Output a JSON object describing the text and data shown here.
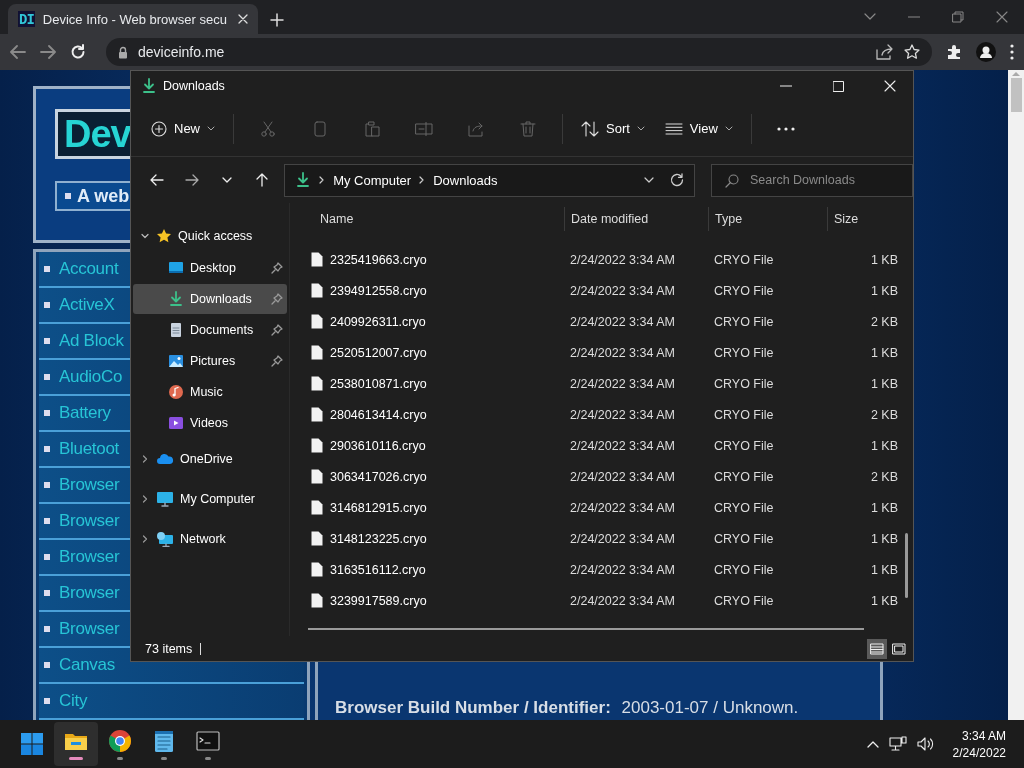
{
  "browser": {
    "tab": {
      "favicon": "DI",
      "title": "Device Info - Web browser secu"
    },
    "url": "deviceinfo.me"
  },
  "website": {
    "logo": "Dev",
    "tagline": "A web",
    "nav": [
      "Account",
      "ActiveX",
      "Ad Block",
      "AudioCo",
      "Battery",
      "Bluetoot",
      "Browser",
      "Browser",
      "Browser",
      "Browser",
      "Browser",
      "Canvas",
      "City"
    ],
    "info": [
      {
        "label": "Browser Build Number / Identifier:",
        "value": "2003-01-07 / Unknown."
      }
    ]
  },
  "explorer": {
    "title": "Downloads",
    "toolbar": {
      "new": "New",
      "actions_disabled": true,
      "sort": "Sort",
      "view": "View"
    },
    "breadcrumb": [
      "My Computer",
      "Downloads"
    ],
    "search": {
      "placeholder": "Search Downloads"
    },
    "nav": [
      {
        "kind": "quick",
        "label": "Quick access",
        "expanded": true,
        "selected": false,
        "children": [
          {
            "kind": "desktop",
            "label": "Desktop",
            "pinned": true,
            "selected": false
          },
          {
            "kind": "downloads",
            "label": "Downloads",
            "pinned": true,
            "selected": true
          },
          {
            "kind": "documents",
            "label": "Documents",
            "pinned": true,
            "selected": false
          },
          {
            "kind": "pictures",
            "label": "Pictures",
            "pinned": true,
            "selected": false
          },
          {
            "kind": "music",
            "label": "Music",
            "pinned": false,
            "selected": false
          },
          {
            "kind": "videos",
            "label": "Videos",
            "pinned": false,
            "selected": false
          }
        ]
      },
      {
        "kind": "onedrive",
        "label": "OneDrive",
        "expanded": false,
        "selected": false
      },
      {
        "kind": "computer",
        "label": "My Computer",
        "expanded": false,
        "selected": false
      },
      {
        "kind": "network",
        "label": "Network",
        "expanded": false,
        "selected": false
      }
    ],
    "columns": [
      "Name",
      "Date modified",
      "Type",
      "Size"
    ],
    "files": [
      {
        "name": "2325419663.cryo",
        "date": "2/24/2022 3:34 AM",
        "type": "CRYO File",
        "size": "1 KB"
      },
      {
        "name": "2394912558.cryo",
        "date": "2/24/2022 3:34 AM",
        "type": "CRYO File",
        "size": "1 KB"
      },
      {
        "name": "2409926311.cryo",
        "date": "2/24/2022 3:34 AM",
        "type": "CRYO File",
        "size": "2 KB"
      },
      {
        "name": "2520512007.cryo",
        "date": "2/24/2022 3:34 AM",
        "type": "CRYO File",
        "size": "1 KB"
      },
      {
        "name": "2538010871.cryo",
        "date": "2/24/2022 3:34 AM",
        "type": "CRYO File",
        "size": "1 KB"
      },
      {
        "name": "2804613414.cryo",
        "date": "2/24/2022 3:34 AM",
        "type": "CRYO File",
        "size": "2 KB"
      },
      {
        "name": "2903610116.cryo",
        "date": "2/24/2022 3:34 AM",
        "type": "CRYO File",
        "size": "1 KB"
      },
      {
        "name": "3063417026.cryo",
        "date": "2/24/2022 3:34 AM",
        "type": "CRYO File",
        "size": "2 KB"
      },
      {
        "name": "3146812915.cryo",
        "date": "2/24/2022 3:34 AM",
        "type": "CRYO File",
        "size": "1 KB"
      },
      {
        "name": "3148123225.cryo",
        "date": "2/24/2022 3:34 AM",
        "type": "CRYO File",
        "size": "1 KB"
      },
      {
        "name": "3163516112.cryo",
        "date": "2/24/2022 3:34 AM",
        "type": "CRYO File",
        "size": "1 KB"
      },
      {
        "name": "3239917589.cryo",
        "date": "2/24/2022 3:34 AM",
        "type": "CRYO File",
        "size": "1 KB"
      }
    ],
    "status": "73 items",
    "views": [
      {
        "kind": "details",
        "selected": true
      },
      {
        "kind": "tiles",
        "selected": false
      }
    ]
  },
  "taskbar": {
    "apps": [
      {
        "kind": "start",
        "selected": false
      },
      {
        "kind": "explorer",
        "selected": true
      },
      {
        "kind": "chrome",
        "selected": false
      },
      {
        "kind": "notepad",
        "selected": false
      },
      {
        "kind": "terminal",
        "selected": false
      }
    ],
    "time": "3:34 AM",
    "date": "2/24/2022"
  }
}
